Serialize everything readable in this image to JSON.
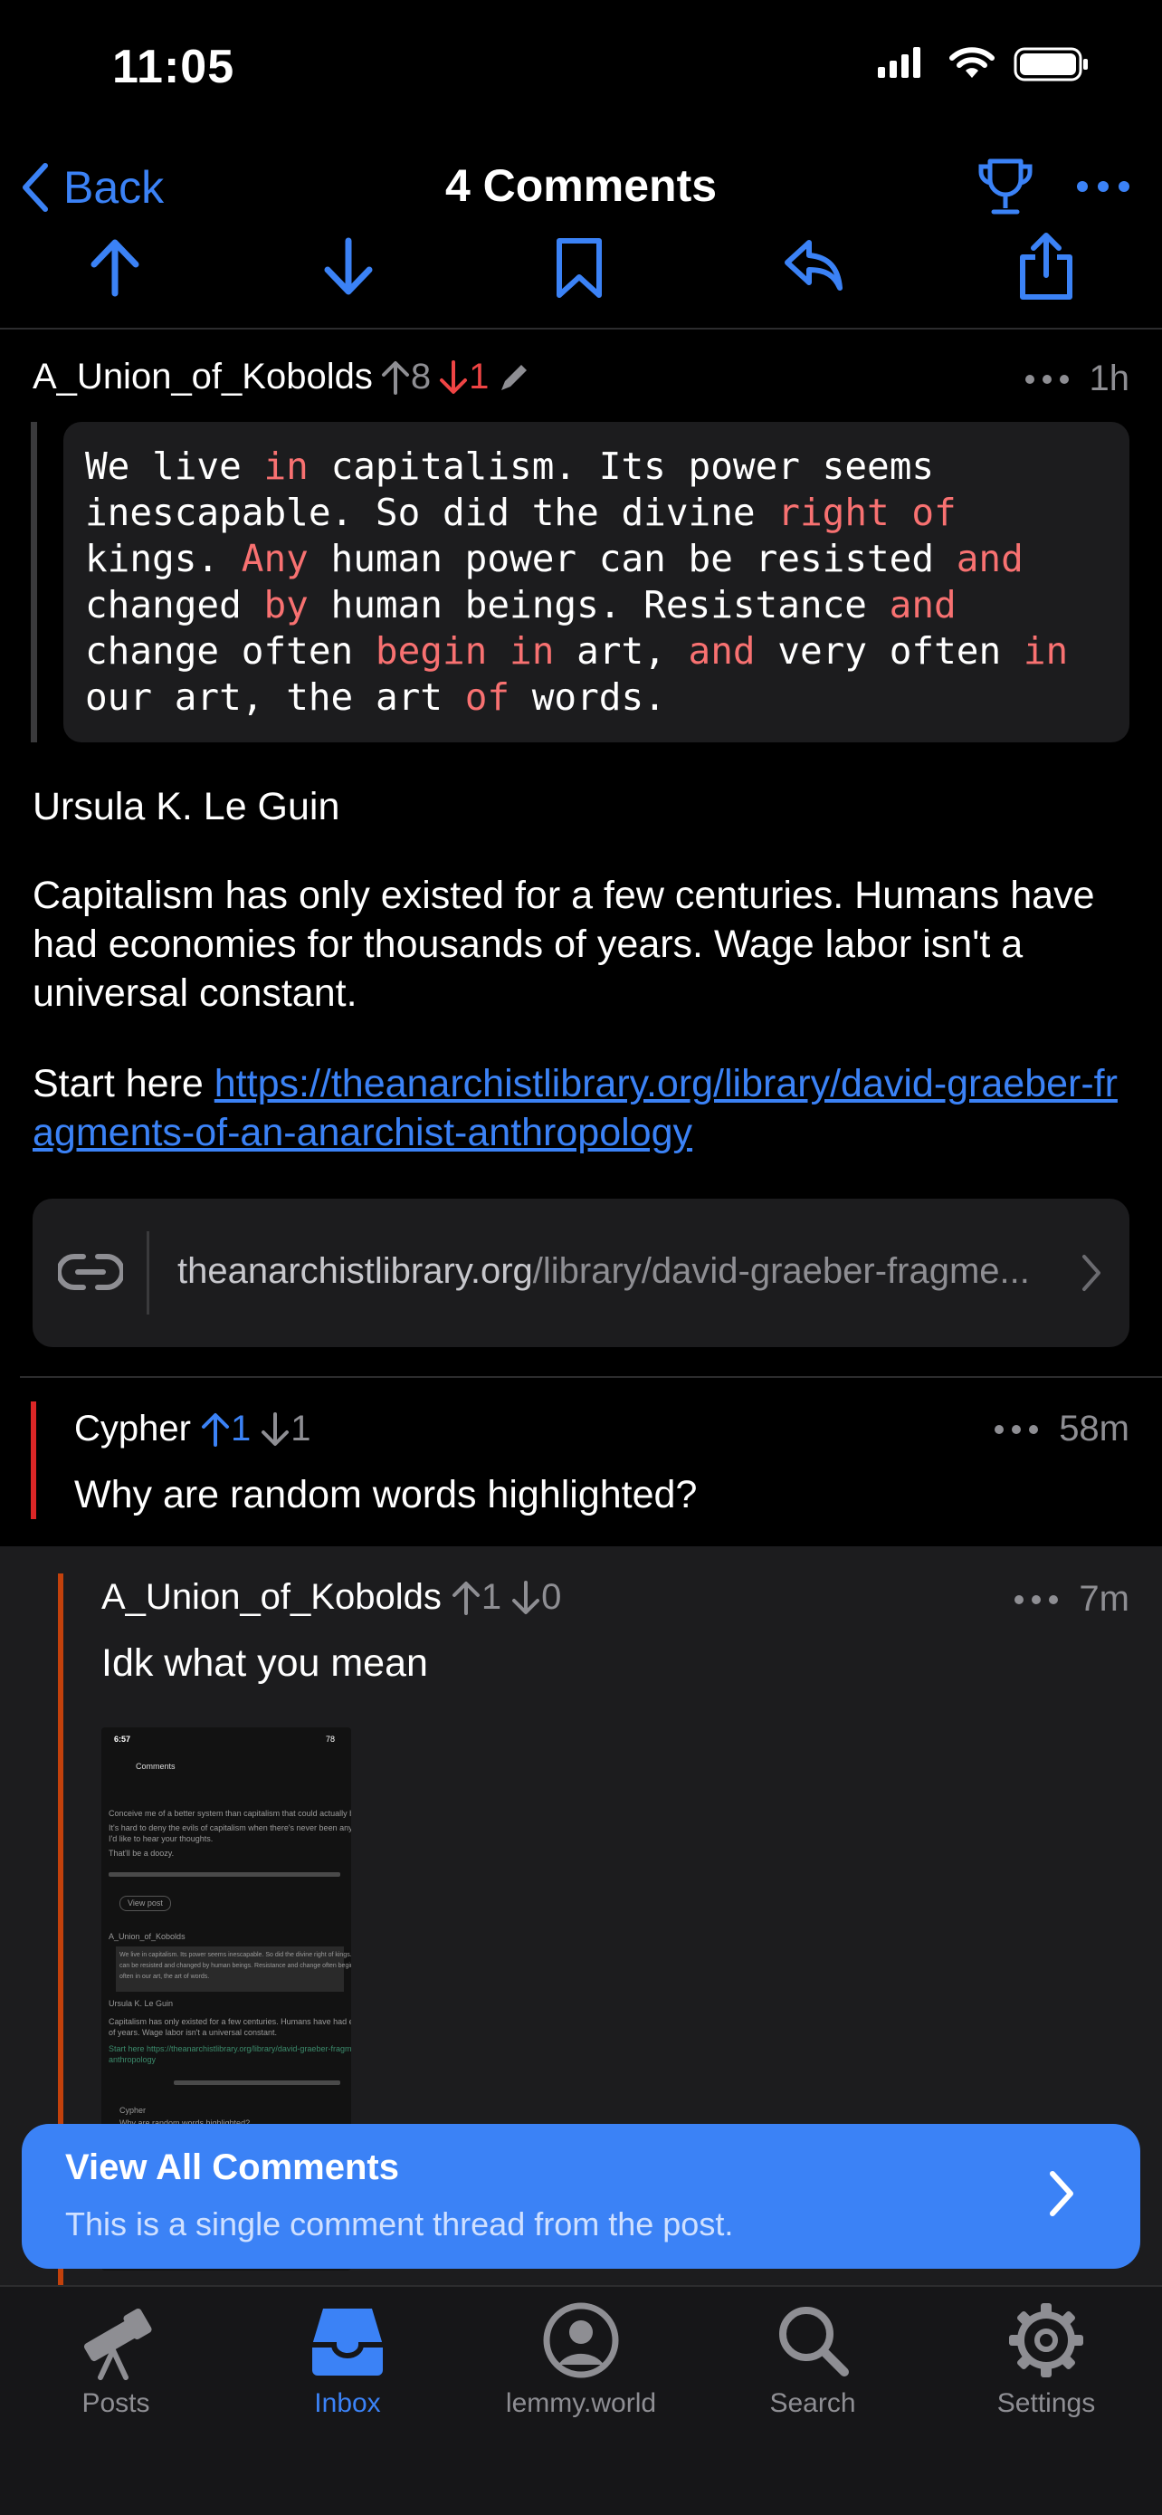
{
  "status_bar": {
    "time": "11:05"
  },
  "nav": {
    "back_label": "Back",
    "title": "4 Comments"
  },
  "comments": [
    {
      "author": "A_Union_of_Kobolds",
      "upvotes": "8",
      "downvotes": "1",
      "time": "1h",
      "quote_lines": [
        "We live in capitalism. Its power seems",
        "inescapable. So did the divine right of",
        "kings. Any human power can be resisted and",
        "changed by human beings. Resistance and",
        "change often begin in art, and very often in",
        "our art, the art of words."
      ],
      "attribution": "Ursula K. Le Guin",
      "paragraph": "Capitalism has only existed for a few centuries. Humans have had economies for thousands of years. Wage labor isn't a universal constant.",
      "start_prefix": "Start here ",
      "link_url": "https://theanarchistlibrary.org/library/david-graeber-fragments-of-an-anarchist-anthropology",
      "link_preview_host": "theanarchistlibrary.org",
      "link_preview_path": "/library/david-graeber-fragme..."
    },
    {
      "author": "Cypher",
      "upvotes": "1",
      "downvotes": "1",
      "time": "58m",
      "body": "Why are random words highlighted?"
    },
    {
      "author": "A_Union_of_Kobolds",
      "upvotes": "1",
      "downvotes": "0",
      "time": "7m",
      "body": "Idk what you mean"
    }
  ],
  "thumbnail": {
    "time": "6:57",
    "battery": "78",
    "title": "Comments",
    "lines": [
      "Conceive me of a better system than capitalism that could actually be implemented",
      "It's hard to deny the evils of capitalism when there's never been any other successful systems.",
      "I'd like to hear your thoughts.",
      "That'll be a doozy.",
      "View post",
      "A_Union_of_Kobolds",
      "We live in capitalism. Its power seems inescapable. So did the divine right of kings. Any human power",
      "can be resisted and changed by human beings. Resistance and change often begin in art, and very",
      "often in our art, the art of words.",
      "Ursula K. Le Guin",
      "Capitalism has only existed for a few centuries. Humans have had economies for thousands",
      "of years. Wage labor isn't a universal constant.",
      "Start here https://theanarchistlibrary.org/library/david-graeber-fragments-of-an-anarchist-",
      "anthropology",
      "Cypher",
      "Why are random words highlighted?"
    ]
  },
  "banner": {
    "title": "View All Comments",
    "subtitle": "This is a single comment thread from the post."
  },
  "tabs": [
    {
      "label": "Posts",
      "icon": "telescope-icon",
      "active": false
    },
    {
      "label": "Inbox",
      "icon": "inbox-tray-icon",
      "active": true
    },
    {
      "label": "lemmy.world",
      "icon": "profile-circle-icon",
      "active": false
    },
    {
      "label": "Search",
      "icon": "magnifier-icon",
      "active": false
    },
    {
      "label": "Settings",
      "icon": "gear-icon",
      "active": false
    }
  ],
  "colors": {
    "accent": "#3b82f6",
    "downvote": "#ef4444",
    "keyword": "#f87171",
    "thread_red": "#dc2626",
    "thread_orange": "#c2410c"
  }
}
